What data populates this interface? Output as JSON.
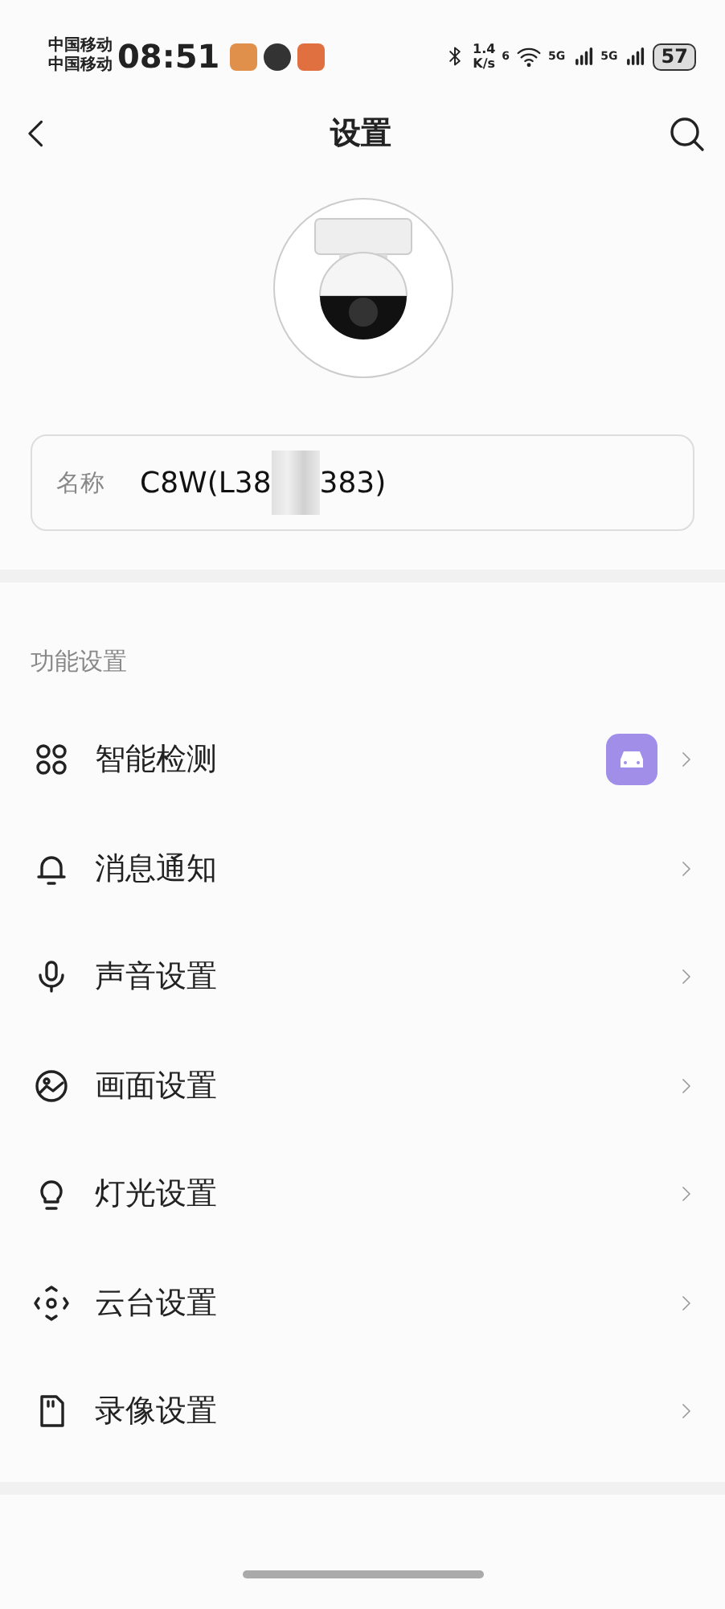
{
  "status_bar": {
    "carriers": [
      "中国移动",
      "中国移动"
    ],
    "time": "08:51",
    "speed": "1.4",
    "speed_unit": "K/s",
    "wifi_label": "6",
    "signals": [
      "5G",
      "5G"
    ],
    "battery": "57"
  },
  "header": {
    "title": "设置"
  },
  "device": {
    "name_label": "名称",
    "name_start": "C8W(L38",
    "name_end": "383)"
  },
  "section": {
    "title": "功能设置"
  },
  "menu": [
    {
      "kind": "grid",
      "label": "智能检测",
      "badge": true
    },
    {
      "kind": "bell",
      "label": "消息通知",
      "badge": false
    },
    {
      "kind": "mic",
      "label": "声音设置",
      "badge": false
    },
    {
      "kind": "image",
      "label": "画面设置",
      "badge": false
    },
    {
      "kind": "bulb",
      "label": "灯光设置",
      "badge": false
    },
    {
      "kind": "ptz",
      "label": "云台设置",
      "badge": false
    },
    {
      "kind": "card",
      "label": "录像设置",
      "badge": false
    }
  ]
}
